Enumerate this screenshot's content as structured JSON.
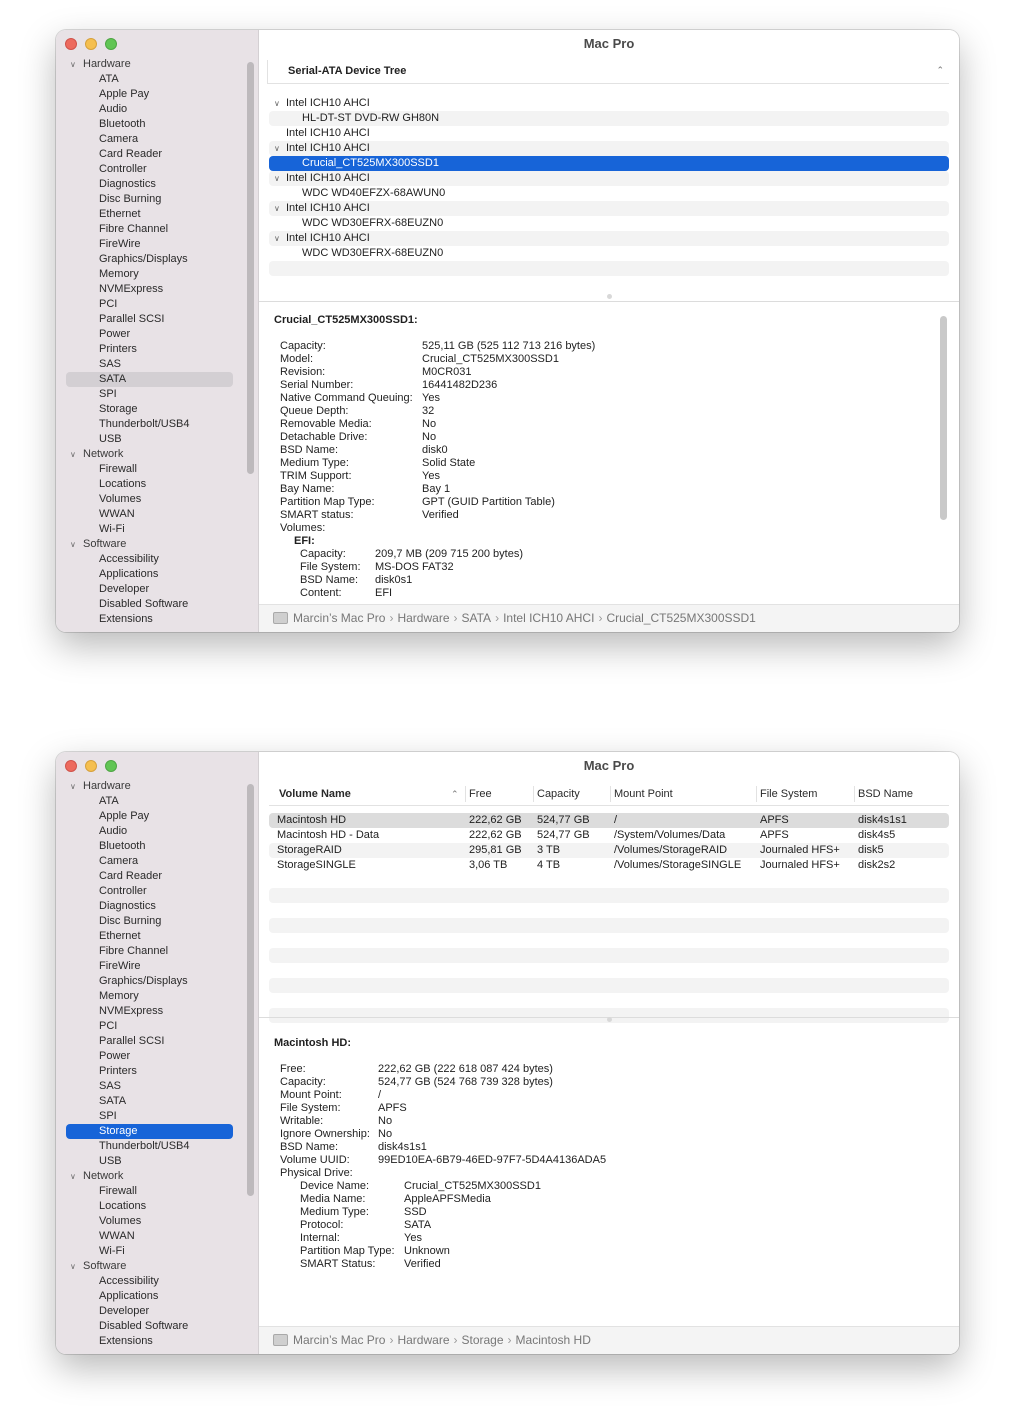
{
  "window1": {
    "title": "Mac Pro",
    "sidebar": {
      "hardware_label": "Hardware",
      "hardware_items": [
        "ATA",
        "Apple Pay",
        "Audio",
        "Bluetooth",
        "Camera",
        "Card Reader",
        "Controller",
        "Diagnostics",
        "Disc Burning",
        "Ethernet",
        "Fibre Channel",
        "FireWire",
        "Graphics/Displays",
        "Memory",
        "NVMExpress",
        "PCI",
        "Parallel SCSI",
        "Power",
        "Printers",
        "SAS",
        "SATA",
        "SPI",
        "Storage",
        "Thunderbolt/USB4",
        "USB"
      ],
      "network_label": "Network",
      "network_items": [
        "Firewall",
        "Locations",
        "Volumes",
        "WWAN",
        "Wi-Fi"
      ],
      "software_label": "Software",
      "software_items": [
        "Accessibility",
        "Applications",
        "Developer",
        "Disabled Software",
        "Extensions"
      ],
      "selected": "SATA"
    },
    "tree": {
      "header": "Serial-ATA Device Tree",
      "rows": [
        {
          "label": "Intel ICH10 AHCI",
          "level": 0,
          "expanded": true
        },
        {
          "label": "HL-DT-ST DVD-RW GH80N",
          "level": 1
        },
        {
          "label": "Intel ICH10 AHCI",
          "level": 0,
          "expanded": false
        },
        {
          "label": "Intel ICH10 AHCI",
          "level": 0,
          "expanded": true
        },
        {
          "label": "Crucial_CT525MX300SSD1",
          "level": 1,
          "selected": true
        },
        {
          "label": "Intel ICH10 AHCI",
          "level": 0,
          "expanded": true
        },
        {
          "label": "WDC WD40EFZX-68AWUN0",
          "level": 1
        },
        {
          "label": "Intel ICH10 AHCI",
          "level": 0,
          "expanded": true
        },
        {
          "label": "WDC WD30EFRX-68EUZN0",
          "level": 1
        },
        {
          "label": "Intel ICH10 AHCI",
          "level": 0,
          "expanded": true
        },
        {
          "label": "WDC WD30EFRX-68EUZN0",
          "level": 1
        }
      ]
    },
    "detail": {
      "title": "Crucial_CT525MX300SSD1:",
      "rows": [
        {
          "k": "Capacity:",
          "v": "525,11 GB (525 112 713 216 bytes)"
        },
        {
          "k": "Model:",
          "v": "Crucial_CT525MX300SSD1"
        },
        {
          "k": "Revision:",
          "v": " M0CR031"
        },
        {
          "k": "Serial Number:",
          "v": "16441482D236"
        },
        {
          "k": "Native Command Queuing:",
          "v": "Yes"
        },
        {
          "k": "Queue Depth:",
          "v": "32"
        },
        {
          "k": "Removable Media:",
          "v": "No"
        },
        {
          "k": "Detachable Drive:",
          "v": "No"
        },
        {
          "k": "BSD Name:",
          "v": "disk0"
        },
        {
          "k": "Medium Type:",
          "v": "Solid State"
        },
        {
          "k": "TRIM Support:",
          "v": "Yes"
        },
        {
          "k": "Bay Name:",
          "v": "Bay 1"
        },
        {
          "k": "Partition Map Type:",
          "v": "GPT (GUID Partition Table)"
        },
        {
          "k": "SMART status:",
          "v": "Verified"
        },
        {
          "k": "Volumes:",
          "v": ""
        },
        {
          "k": "EFI:",
          "v": "",
          "style": "bold"
        },
        {
          "k": "Capacity:",
          "v": "209,7 MB (209 715 200 bytes)",
          "style": "sub"
        },
        {
          "k": "File System:",
          "v": "MS-DOS FAT32",
          "style": "sub"
        },
        {
          "k": "BSD Name:",
          "v": "disk0s1",
          "style": "sub"
        },
        {
          "k": "Content:",
          "v": "EFI",
          "style": "sub"
        }
      ]
    },
    "path": [
      "Marcin’s Mac Pro",
      "Hardware",
      "SATA",
      "Intel ICH10 AHCI",
      "Crucial_CT525MX300SSD1"
    ]
  },
  "window2": {
    "title": "Mac Pro",
    "sidebar": {
      "hardware_label": "Hardware",
      "hardware_items": [
        "ATA",
        "Apple Pay",
        "Audio",
        "Bluetooth",
        "Camera",
        "Card Reader",
        "Controller",
        "Diagnostics",
        "Disc Burning",
        "Ethernet",
        "Fibre Channel",
        "FireWire",
        "Graphics/Displays",
        "Memory",
        "NVMExpress",
        "PCI",
        "Parallel SCSI",
        "Power",
        "Printers",
        "SAS",
        "SATA",
        "SPI",
        "Storage",
        "Thunderbolt/USB4",
        "USB"
      ],
      "network_label": "Network",
      "network_items": [
        "Firewall",
        "Locations",
        "Volumes",
        "WWAN",
        "Wi-Fi"
      ],
      "software_label": "Software",
      "software_items": [
        "Accessibility",
        "Applications",
        "Developer",
        "Disabled Software",
        "Extensions"
      ],
      "selected": "Storage"
    },
    "table": {
      "columns": [
        "Volume Name",
        "Free",
        "Capacity",
        "Mount Point",
        "File System",
        "BSD Name"
      ],
      "rows": [
        [
          "Macintosh HD",
          "222,62 GB",
          "524,77 GB",
          "/",
          "APFS",
          "disk4s1s1"
        ],
        [
          "Macintosh HD - Data",
          "222,62 GB",
          "524,77 GB",
          "/System/Volumes/Data",
          "APFS",
          "disk4s5"
        ],
        [
          "StorageRAID",
          "295,81 GB",
          "3 TB",
          "/Volumes/StorageRAID",
          "Journaled HFS+",
          "disk5"
        ],
        [
          "StorageSINGLE",
          "3,06 TB",
          "4 TB",
          "/Volumes/StorageSINGLE",
          "Journaled HFS+",
          "disk2s2"
        ]
      ]
    },
    "detail": {
      "title": "Macintosh HD:",
      "rows": [
        {
          "k": "Free:",
          "v": "222,62 GB (222 618 087 424 bytes)"
        },
        {
          "k": "Capacity:",
          "v": "524,77 GB (524 768 739 328 bytes)"
        },
        {
          "k": "Mount Point:",
          "v": "/"
        },
        {
          "k": "File System:",
          "v": "APFS"
        },
        {
          "k": "Writable:",
          "v": "No"
        },
        {
          "k": "Ignore Ownership:",
          "v": "No"
        },
        {
          "k": "BSD Name:",
          "v": "disk4s1s1"
        },
        {
          "k": "Volume UUID:",
          "v": "99ED10EA-6B79-46ED-97F7-5D4A4136ADA5"
        },
        {
          "k": "Physical Drive:",
          "v": ""
        },
        {
          "k": "Device Name:",
          "v": "Crucial_CT525MX300SSD1",
          "style": "sub"
        },
        {
          "k": "Media Name:",
          "v": "AppleAPFSMedia",
          "style": "sub"
        },
        {
          "k": "Medium Type:",
          "v": "SSD",
          "style": "sub"
        },
        {
          "k": "Protocol:",
          "v": "SATA",
          "style": "sub"
        },
        {
          "k": "Internal:",
          "v": "Yes",
          "style": "sub"
        },
        {
          "k": "Partition Map Type:",
          "v": "Unknown",
          "style": "sub"
        },
        {
          "k": "SMART Status:",
          "v": "Verified",
          "style": "sub"
        }
      ]
    },
    "path": [
      "Marcin’s Mac Pro",
      "Hardware",
      "Storage",
      "Macintosh HD"
    ]
  },
  "colors": {
    "selection_blue": "#1764d8",
    "sidebar_bg": "#e8e2e6"
  },
  "icons": [
    "close-icon",
    "minimize-icon",
    "zoom-icon",
    "chevron-down-icon",
    "chevron-up-icon",
    "hard-drive-icon"
  ]
}
